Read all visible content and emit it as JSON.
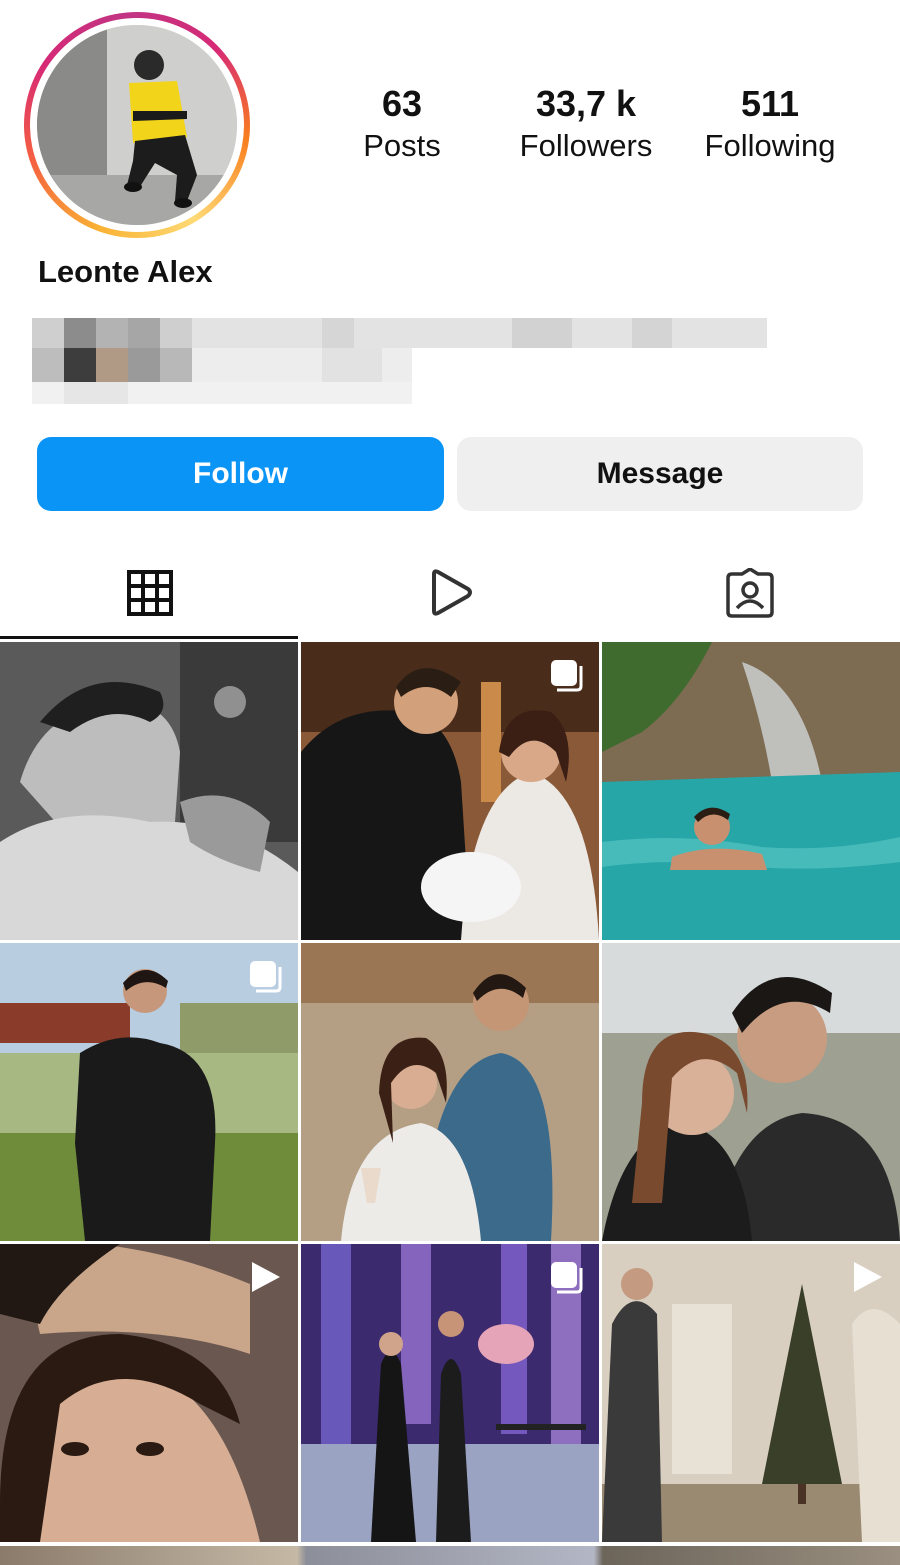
{
  "profile": {
    "username": "Leonte Alex",
    "stats": [
      {
        "value": "63",
        "label": "Posts"
      },
      {
        "value": "33,7 k",
        "label": "Followers"
      },
      {
        "value": "511",
        "label": "Following"
      }
    ]
  },
  "actions": {
    "follow_label": "Follow",
    "message_label": "Message"
  },
  "tabs": [
    {
      "icon": "grid-icon",
      "active": true
    },
    {
      "icon": "reels-play-icon",
      "active": false
    },
    {
      "icon": "tagged-person-icon",
      "active": false
    }
  ],
  "colors": {
    "follow_blue": "#0a95f6",
    "message_gray": "#efefef",
    "ring_gradient": [
      "#feda75",
      "#fa7e1e",
      "#d62976",
      "#c13584"
    ]
  },
  "posts": [
    {
      "scene": "bw-portrait-smoking",
      "badge": "none"
    },
    {
      "scene": "couple-with-baby",
      "badge": "carousel-icon"
    },
    {
      "scene": "swimming-waterfall",
      "badge": "none"
    },
    {
      "scene": "man-black-suit-lake",
      "badge": "carousel-icon"
    },
    {
      "scene": "couple-wine-field",
      "badge": "none"
    },
    {
      "scene": "couple-selfie",
      "badge": "none"
    },
    {
      "scene": "couple-close-up",
      "badge": "reel-icon"
    },
    {
      "scene": "stage-performance",
      "badge": "carousel-icon"
    },
    {
      "scene": "room-christmas-tree",
      "badge": "reel-icon"
    }
  ]
}
